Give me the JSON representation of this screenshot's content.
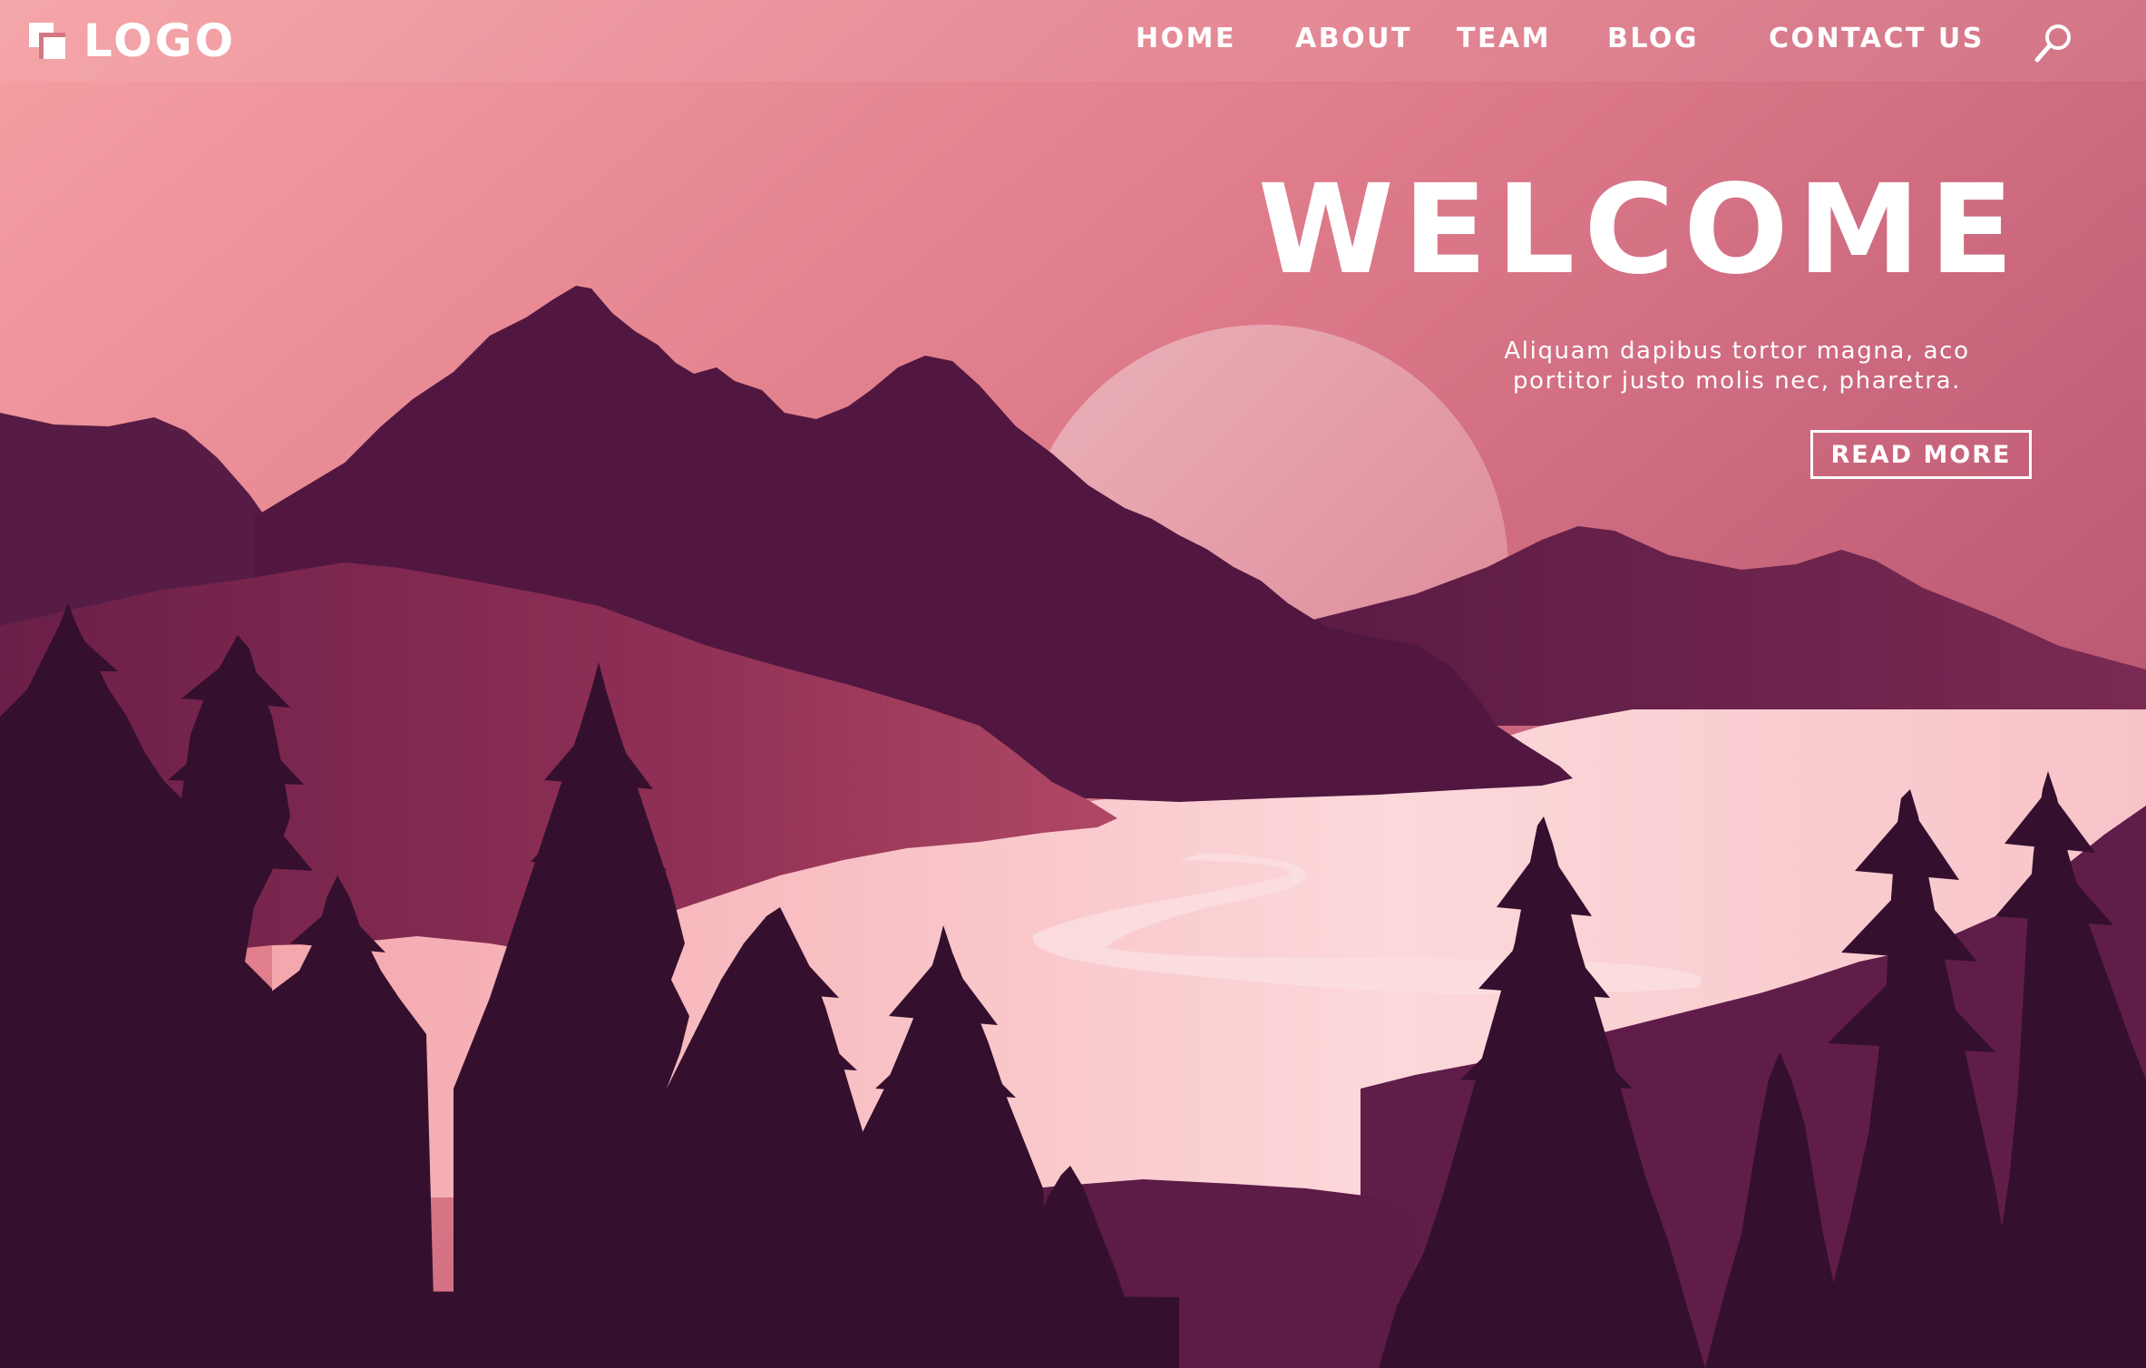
{
  "header": {
    "logo_text": "LOGO",
    "nav": [
      {
        "label": "HOME"
      },
      {
        "label": "ABOUT"
      },
      {
        "label": "TEAM"
      },
      {
        "label": "BLOG"
      },
      {
        "label": "CONTACT US"
      }
    ],
    "search_icon": "search-icon"
  },
  "hero": {
    "title": "WELCOME",
    "text_lines": [
      "Aliquam dapibus tortor magna, aco",
      "portitor justo molis nec, pharetra."
    ],
    "button_label": "READ MORE"
  },
  "colors": {
    "sky_top": "#f19aa0",
    "sky_bottom": "#b9536e",
    "sun": "#e8a8b0",
    "lake": "#fad3d6",
    "mountain_far": "#5b1d45",
    "mountain_mid": "#4e1740",
    "tree_dark": "#33112e",
    "accent_text": "#ffffff"
  }
}
